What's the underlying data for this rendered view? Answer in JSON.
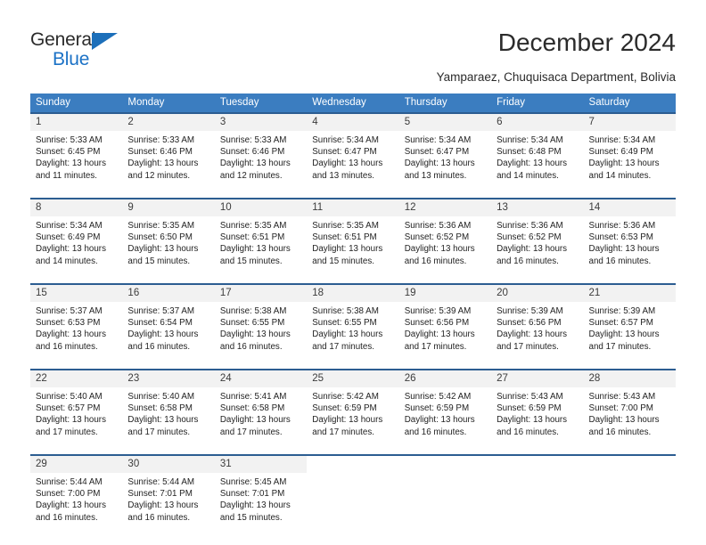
{
  "brand": {
    "name_part1": "General",
    "name_part2": "Blue"
  },
  "header": {
    "title": "December 2024",
    "subtitle": "Yamparaez, Chuquisaca Department, Bolivia"
  },
  "calendar": {
    "weekday_headers": [
      "Sunday",
      "Monday",
      "Tuesday",
      "Wednesday",
      "Thursday",
      "Friday",
      "Saturday"
    ],
    "accent_color": "#3b7dc0",
    "accent_border_color": "#2c5d91",
    "daynum_background": "#f2f2f2",
    "weeks": [
      [
        {
          "day": "1",
          "sunrise": "Sunrise: 5:33 AM",
          "sunset": "Sunset: 6:45 PM",
          "daylight_line1": "Daylight: 13 hours",
          "daylight_line2": "and 11 minutes."
        },
        {
          "day": "2",
          "sunrise": "Sunrise: 5:33 AM",
          "sunset": "Sunset: 6:46 PM",
          "daylight_line1": "Daylight: 13 hours",
          "daylight_line2": "and 12 minutes."
        },
        {
          "day": "3",
          "sunrise": "Sunrise: 5:33 AM",
          "sunset": "Sunset: 6:46 PM",
          "daylight_line1": "Daylight: 13 hours",
          "daylight_line2": "and 12 minutes."
        },
        {
          "day": "4",
          "sunrise": "Sunrise: 5:34 AM",
          "sunset": "Sunset: 6:47 PM",
          "daylight_line1": "Daylight: 13 hours",
          "daylight_line2": "and 13 minutes."
        },
        {
          "day": "5",
          "sunrise": "Sunrise: 5:34 AM",
          "sunset": "Sunset: 6:47 PM",
          "daylight_line1": "Daylight: 13 hours",
          "daylight_line2": "and 13 minutes."
        },
        {
          "day": "6",
          "sunrise": "Sunrise: 5:34 AM",
          "sunset": "Sunset: 6:48 PM",
          "daylight_line1": "Daylight: 13 hours",
          "daylight_line2": "and 14 minutes."
        },
        {
          "day": "7",
          "sunrise": "Sunrise: 5:34 AM",
          "sunset": "Sunset: 6:49 PM",
          "daylight_line1": "Daylight: 13 hours",
          "daylight_line2": "and 14 minutes."
        }
      ],
      [
        {
          "day": "8",
          "sunrise": "Sunrise: 5:34 AM",
          "sunset": "Sunset: 6:49 PM",
          "daylight_line1": "Daylight: 13 hours",
          "daylight_line2": "and 14 minutes."
        },
        {
          "day": "9",
          "sunrise": "Sunrise: 5:35 AM",
          "sunset": "Sunset: 6:50 PM",
          "daylight_line1": "Daylight: 13 hours",
          "daylight_line2": "and 15 minutes."
        },
        {
          "day": "10",
          "sunrise": "Sunrise: 5:35 AM",
          "sunset": "Sunset: 6:51 PM",
          "daylight_line1": "Daylight: 13 hours",
          "daylight_line2": "and 15 minutes."
        },
        {
          "day": "11",
          "sunrise": "Sunrise: 5:35 AM",
          "sunset": "Sunset: 6:51 PM",
          "daylight_line1": "Daylight: 13 hours",
          "daylight_line2": "and 15 minutes."
        },
        {
          "day": "12",
          "sunrise": "Sunrise: 5:36 AM",
          "sunset": "Sunset: 6:52 PM",
          "daylight_line1": "Daylight: 13 hours",
          "daylight_line2": "and 16 minutes."
        },
        {
          "day": "13",
          "sunrise": "Sunrise: 5:36 AM",
          "sunset": "Sunset: 6:52 PM",
          "daylight_line1": "Daylight: 13 hours",
          "daylight_line2": "and 16 minutes."
        },
        {
          "day": "14",
          "sunrise": "Sunrise: 5:36 AM",
          "sunset": "Sunset: 6:53 PM",
          "daylight_line1": "Daylight: 13 hours",
          "daylight_line2": "and 16 minutes."
        }
      ],
      [
        {
          "day": "15",
          "sunrise": "Sunrise: 5:37 AM",
          "sunset": "Sunset: 6:53 PM",
          "daylight_line1": "Daylight: 13 hours",
          "daylight_line2": "and 16 minutes."
        },
        {
          "day": "16",
          "sunrise": "Sunrise: 5:37 AM",
          "sunset": "Sunset: 6:54 PM",
          "daylight_line1": "Daylight: 13 hours",
          "daylight_line2": "and 16 minutes."
        },
        {
          "day": "17",
          "sunrise": "Sunrise: 5:38 AM",
          "sunset": "Sunset: 6:55 PM",
          "daylight_line1": "Daylight: 13 hours",
          "daylight_line2": "and 16 minutes."
        },
        {
          "day": "18",
          "sunrise": "Sunrise: 5:38 AM",
          "sunset": "Sunset: 6:55 PM",
          "daylight_line1": "Daylight: 13 hours",
          "daylight_line2": "and 17 minutes."
        },
        {
          "day": "19",
          "sunrise": "Sunrise: 5:39 AM",
          "sunset": "Sunset: 6:56 PM",
          "daylight_line1": "Daylight: 13 hours",
          "daylight_line2": "and 17 minutes."
        },
        {
          "day": "20",
          "sunrise": "Sunrise: 5:39 AM",
          "sunset": "Sunset: 6:56 PM",
          "daylight_line1": "Daylight: 13 hours",
          "daylight_line2": "and 17 minutes."
        },
        {
          "day": "21",
          "sunrise": "Sunrise: 5:39 AM",
          "sunset": "Sunset: 6:57 PM",
          "daylight_line1": "Daylight: 13 hours",
          "daylight_line2": "and 17 minutes."
        }
      ],
      [
        {
          "day": "22",
          "sunrise": "Sunrise: 5:40 AM",
          "sunset": "Sunset: 6:57 PM",
          "daylight_line1": "Daylight: 13 hours",
          "daylight_line2": "and 17 minutes."
        },
        {
          "day": "23",
          "sunrise": "Sunrise: 5:40 AM",
          "sunset": "Sunset: 6:58 PM",
          "daylight_line1": "Daylight: 13 hours",
          "daylight_line2": "and 17 minutes."
        },
        {
          "day": "24",
          "sunrise": "Sunrise: 5:41 AM",
          "sunset": "Sunset: 6:58 PM",
          "daylight_line1": "Daylight: 13 hours",
          "daylight_line2": "and 17 minutes."
        },
        {
          "day": "25",
          "sunrise": "Sunrise: 5:42 AM",
          "sunset": "Sunset: 6:59 PM",
          "daylight_line1": "Daylight: 13 hours",
          "daylight_line2": "and 17 minutes."
        },
        {
          "day": "26",
          "sunrise": "Sunrise: 5:42 AM",
          "sunset": "Sunset: 6:59 PM",
          "daylight_line1": "Daylight: 13 hours",
          "daylight_line2": "and 16 minutes."
        },
        {
          "day": "27",
          "sunrise": "Sunrise: 5:43 AM",
          "sunset": "Sunset: 6:59 PM",
          "daylight_line1": "Daylight: 13 hours",
          "daylight_line2": "and 16 minutes."
        },
        {
          "day": "28",
          "sunrise": "Sunrise: 5:43 AM",
          "sunset": "Sunset: 7:00 PM",
          "daylight_line1": "Daylight: 13 hours",
          "daylight_line2": "and 16 minutes."
        }
      ],
      [
        {
          "day": "29",
          "sunrise": "Sunrise: 5:44 AM",
          "sunset": "Sunset: 7:00 PM",
          "daylight_line1": "Daylight: 13 hours",
          "daylight_line2": "and 16 minutes."
        },
        {
          "day": "30",
          "sunrise": "Sunrise: 5:44 AM",
          "sunset": "Sunset: 7:01 PM",
          "daylight_line1": "Daylight: 13 hours",
          "daylight_line2": "and 16 minutes."
        },
        {
          "day": "31",
          "sunrise": "Sunrise: 5:45 AM",
          "sunset": "Sunset: 7:01 PM",
          "daylight_line1": "Daylight: 13 hours",
          "daylight_line2": "and 15 minutes."
        },
        {
          "day": "",
          "sunrise": "",
          "sunset": "",
          "daylight_line1": "",
          "daylight_line2": ""
        },
        {
          "day": "",
          "sunrise": "",
          "sunset": "",
          "daylight_line1": "",
          "daylight_line2": ""
        },
        {
          "day": "",
          "sunrise": "",
          "sunset": "",
          "daylight_line1": "",
          "daylight_line2": ""
        },
        {
          "day": "",
          "sunrise": "",
          "sunset": "",
          "daylight_line1": "",
          "daylight_line2": ""
        }
      ]
    ]
  }
}
